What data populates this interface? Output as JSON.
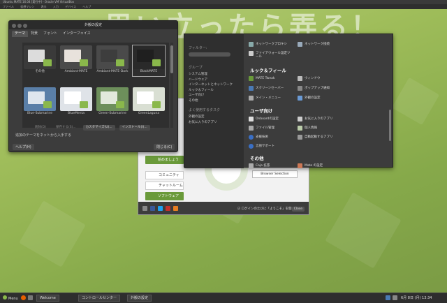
{
  "vbox": {
    "title": "Ubuntu MATE 16.04 [実行中] - Oracle VM VirtualBox",
    "menu": [
      "ファイル",
      "仮想マシン",
      "表示",
      "入力",
      "デバイス",
      "ヘルプ"
    ]
  },
  "banner": "思い立ったら弄る！",
  "appearance": {
    "title": "外観の設定",
    "tabs": [
      "テーマ",
      "背景",
      "フォント",
      "インターフェイス"
    ],
    "themes": [
      {
        "name": "その他",
        "bg": "#3a3a3a",
        "win": "#dcdcdc"
      },
      {
        "name": "Ambiant-MATE",
        "bg": "#4a4a4a",
        "win": "#e8e2dc"
      },
      {
        "name": "Ambiant-MATE-Dark",
        "bg": "#4a4a4a",
        "win": "#3d3d3d"
      },
      {
        "name": "BlackMATE",
        "bg": "#2a2a2a",
        "win": "#1f1f1f"
      },
      {
        "name": "Blue-Submarine",
        "bg": "#5a7fa8",
        "win": "#dfe6ee"
      },
      {
        "name": "BlueMenta",
        "bg": "#dfe3e8",
        "win": "#ffffff"
      },
      {
        "name": "Green-Submarine",
        "bg": "#6d8f5b",
        "win": "#e2e9dc"
      },
      {
        "name": "GreenLaguna",
        "bg": "#d9dfd3",
        "win": "#ffffff"
      }
    ],
    "actions": [
      "削除(D)",
      "保存する(S)...",
      "カスタマイズ(U)...",
      "インストール(I)..."
    ],
    "hint": "追加のテーマをネットから入手する",
    "help": "ヘルプ(H)",
    "close": "閉じる(C)"
  },
  "welcome": {
    "buttons": [
      "始めましょう",
      "コミュニティ",
      "チャットルーム",
      "ソフトウェア"
    ],
    "browser": "Browser Selection",
    "checkbox": "ログインのたびに「ようこそ」を開く",
    "close": "Close",
    "social_icons": [
      "g-plus-icon",
      "facebook-icon",
      "twitter-icon",
      "youtube-icon",
      "rss-icon"
    ]
  },
  "control_center": {
    "filter_label": "フィルター:",
    "groups_label": "グループ",
    "groups": [
      "システム管理",
      "ハードウェア",
      "インターネットとネットワーク",
      "ルック＆フィール",
      "ユーザ向け",
      "その他"
    ],
    "tasks_label": "よく使用するタスク",
    "tasks": [
      "外観の設定",
      "お気に入りのアプリ"
    ],
    "top_items": [
      "ネットワークプロキシ",
      "ネットワーク接続",
      "ファイアウォール設定ツール"
    ],
    "sec_look": "ルック＆フィール",
    "look_items": [
      "MATE Tweak",
      "ウィンドウ",
      "スクリーンセーバー",
      "ポップアップ通知",
      "メイン・メニュー",
      "外観の設定"
    ],
    "sec_user": "ユーザ向け",
    "user_items": [
      "Onboardの設定",
      "お気に入りのアプリ",
      "ファイル管理",
      "個人情報",
      "支援技術",
      "自動起動するアプリ",
      "言語サポート"
    ],
    "sec_other": "その他",
    "other_items": [
      "Caja 拡張",
      "Mate の設定"
    ]
  },
  "taskbar": {
    "menu": "Menu",
    "items": [
      "Welcome",
      "コントロールセンター",
      "外観の設定"
    ],
    "clock": "6月 8日 (月) 13:34"
  }
}
